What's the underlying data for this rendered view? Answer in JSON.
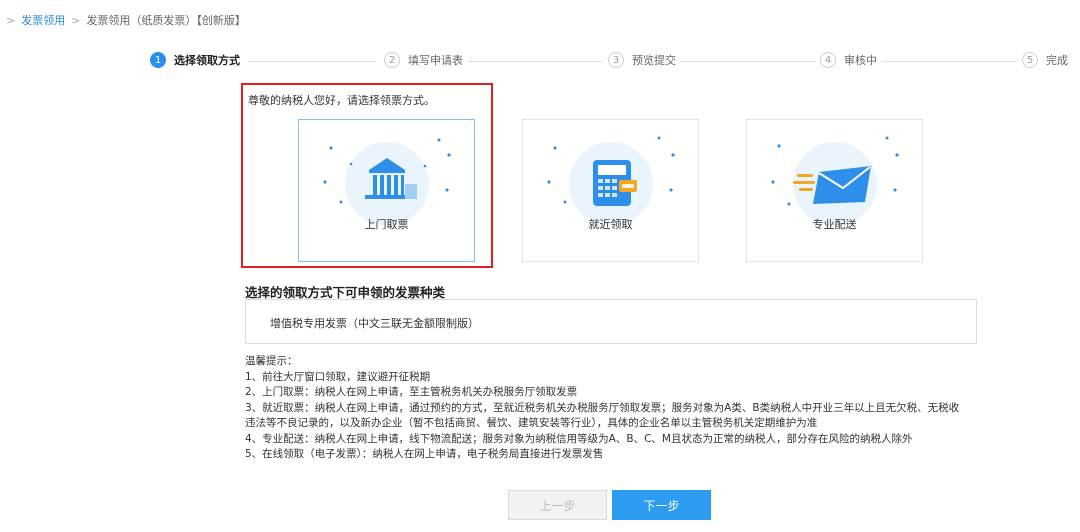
{
  "breadcrumb": {
    "root": "发票领用",
    "current": "发票领用（纸质发票）【创新版】"
  },
  "steps": [
    {
      "num": "1",
      "label": "选择领取方式"
    },
    {
      "num": "2",
      "label": "填写申请表"
    },
    {
      "num": "3",
      "label": "预览提交"
    },
    {
      "num": "4",
      "label": "审核中"
    },
    {
      "num": "5",
      "label": "完成"
    }
  ],
  "greeting": "尊敬的纳税人您好，请选择领票方式。",
  "options": [
    {
      "label": "上门取票",
      "icon": "bank-building-icon"
    },
    {
      "label": "就近领取",
      "icon": "invoice-terminal-icon"
    },
    {
      "label": "专业配送",
      "icon": "envelope-delivery-icon"
    }
  ],
  "section_title": "选择的领取方式下可申领的发票种类",
  "invoice_type": "增值税专用发票（中文三联无金额限制版）",
  "tips": {
    "title": "温馨提示：",
    "lines": [
      "1、前往大厅窗口领取，建议避开征税期",
      "2、上门取票：纳税人在网上申请，至主管税务机关办税服务厅领取发票",
      "3、就近取票：纳税人在网上申请，通过预约的方式，至就近税务机关办税服务厅领取发票；服务对象为A类、B类纳税人中开业三年以上且无欠税、无税收",
      "违法等不良记录的，以及新办企业（暂不包括商贸、餐饮、建筑安装等行业），具体的企业名单以主管税务机关定期维护为准",
      "4、专业配送：纳税人在网上申请，线下物流配送；服务对象为纳税信用等级为A、B、C、M且状态为正常的纳税人，部分存在风险的纳税人除外",
      "5、在线领取（电子发票）：纳税人在网上申请，电子税务局直接进行发票发售"
    ]
  },
  "buttons": {
    "prev": "上一步",
    "next": "下一步"
  },
  "colors": {
    "accent": "#2d9cf0",
    "highlight_border": "#e02020"
  }
}
